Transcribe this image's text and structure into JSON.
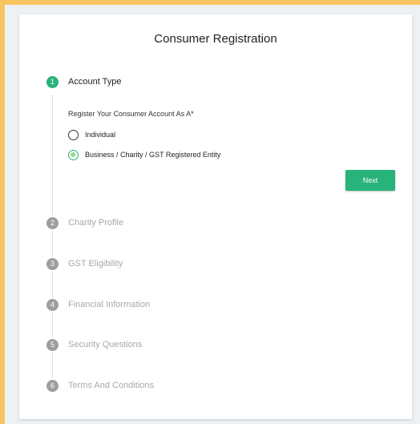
{
  "page": {
    "title": "Consumer Registration"
  },
  "stepper": {
    "steps": [
      {
        "number": "1",
        "label": "Account Type",
        "active": true
      },
      {
        "number": "2",
        "label": "Charity Profile",
        "active": false
      },
      {
        "number": "3",
        "label": "GST Eligibility",
        "active": false
      },
      {
        "number": "4",
        "label": "Financial Information",
        "active": false
      },
      {
        "number": "5",
        "label": "Security Questions",
        "active": false
      },
      {
        "number": "6",
        "label": "Terms And Conditions",
        "active": false
      }
    ]
  },
  "account_type": {
    "question": "Register Your Consumer Account As A*",
    "options": [
      {
        "label": "Individual",
        "selected": false
      },
      {
        "label": "Business / Charity / GST Registered Entity",
        "selected": true
      }
    ],
    "next_label": "Next"
  },
  "colors": {
    "accent": "#27b37a",
    "inactive_step": "#9e9e9e",
    "frame_border": "#f7c55f"
  }
}
